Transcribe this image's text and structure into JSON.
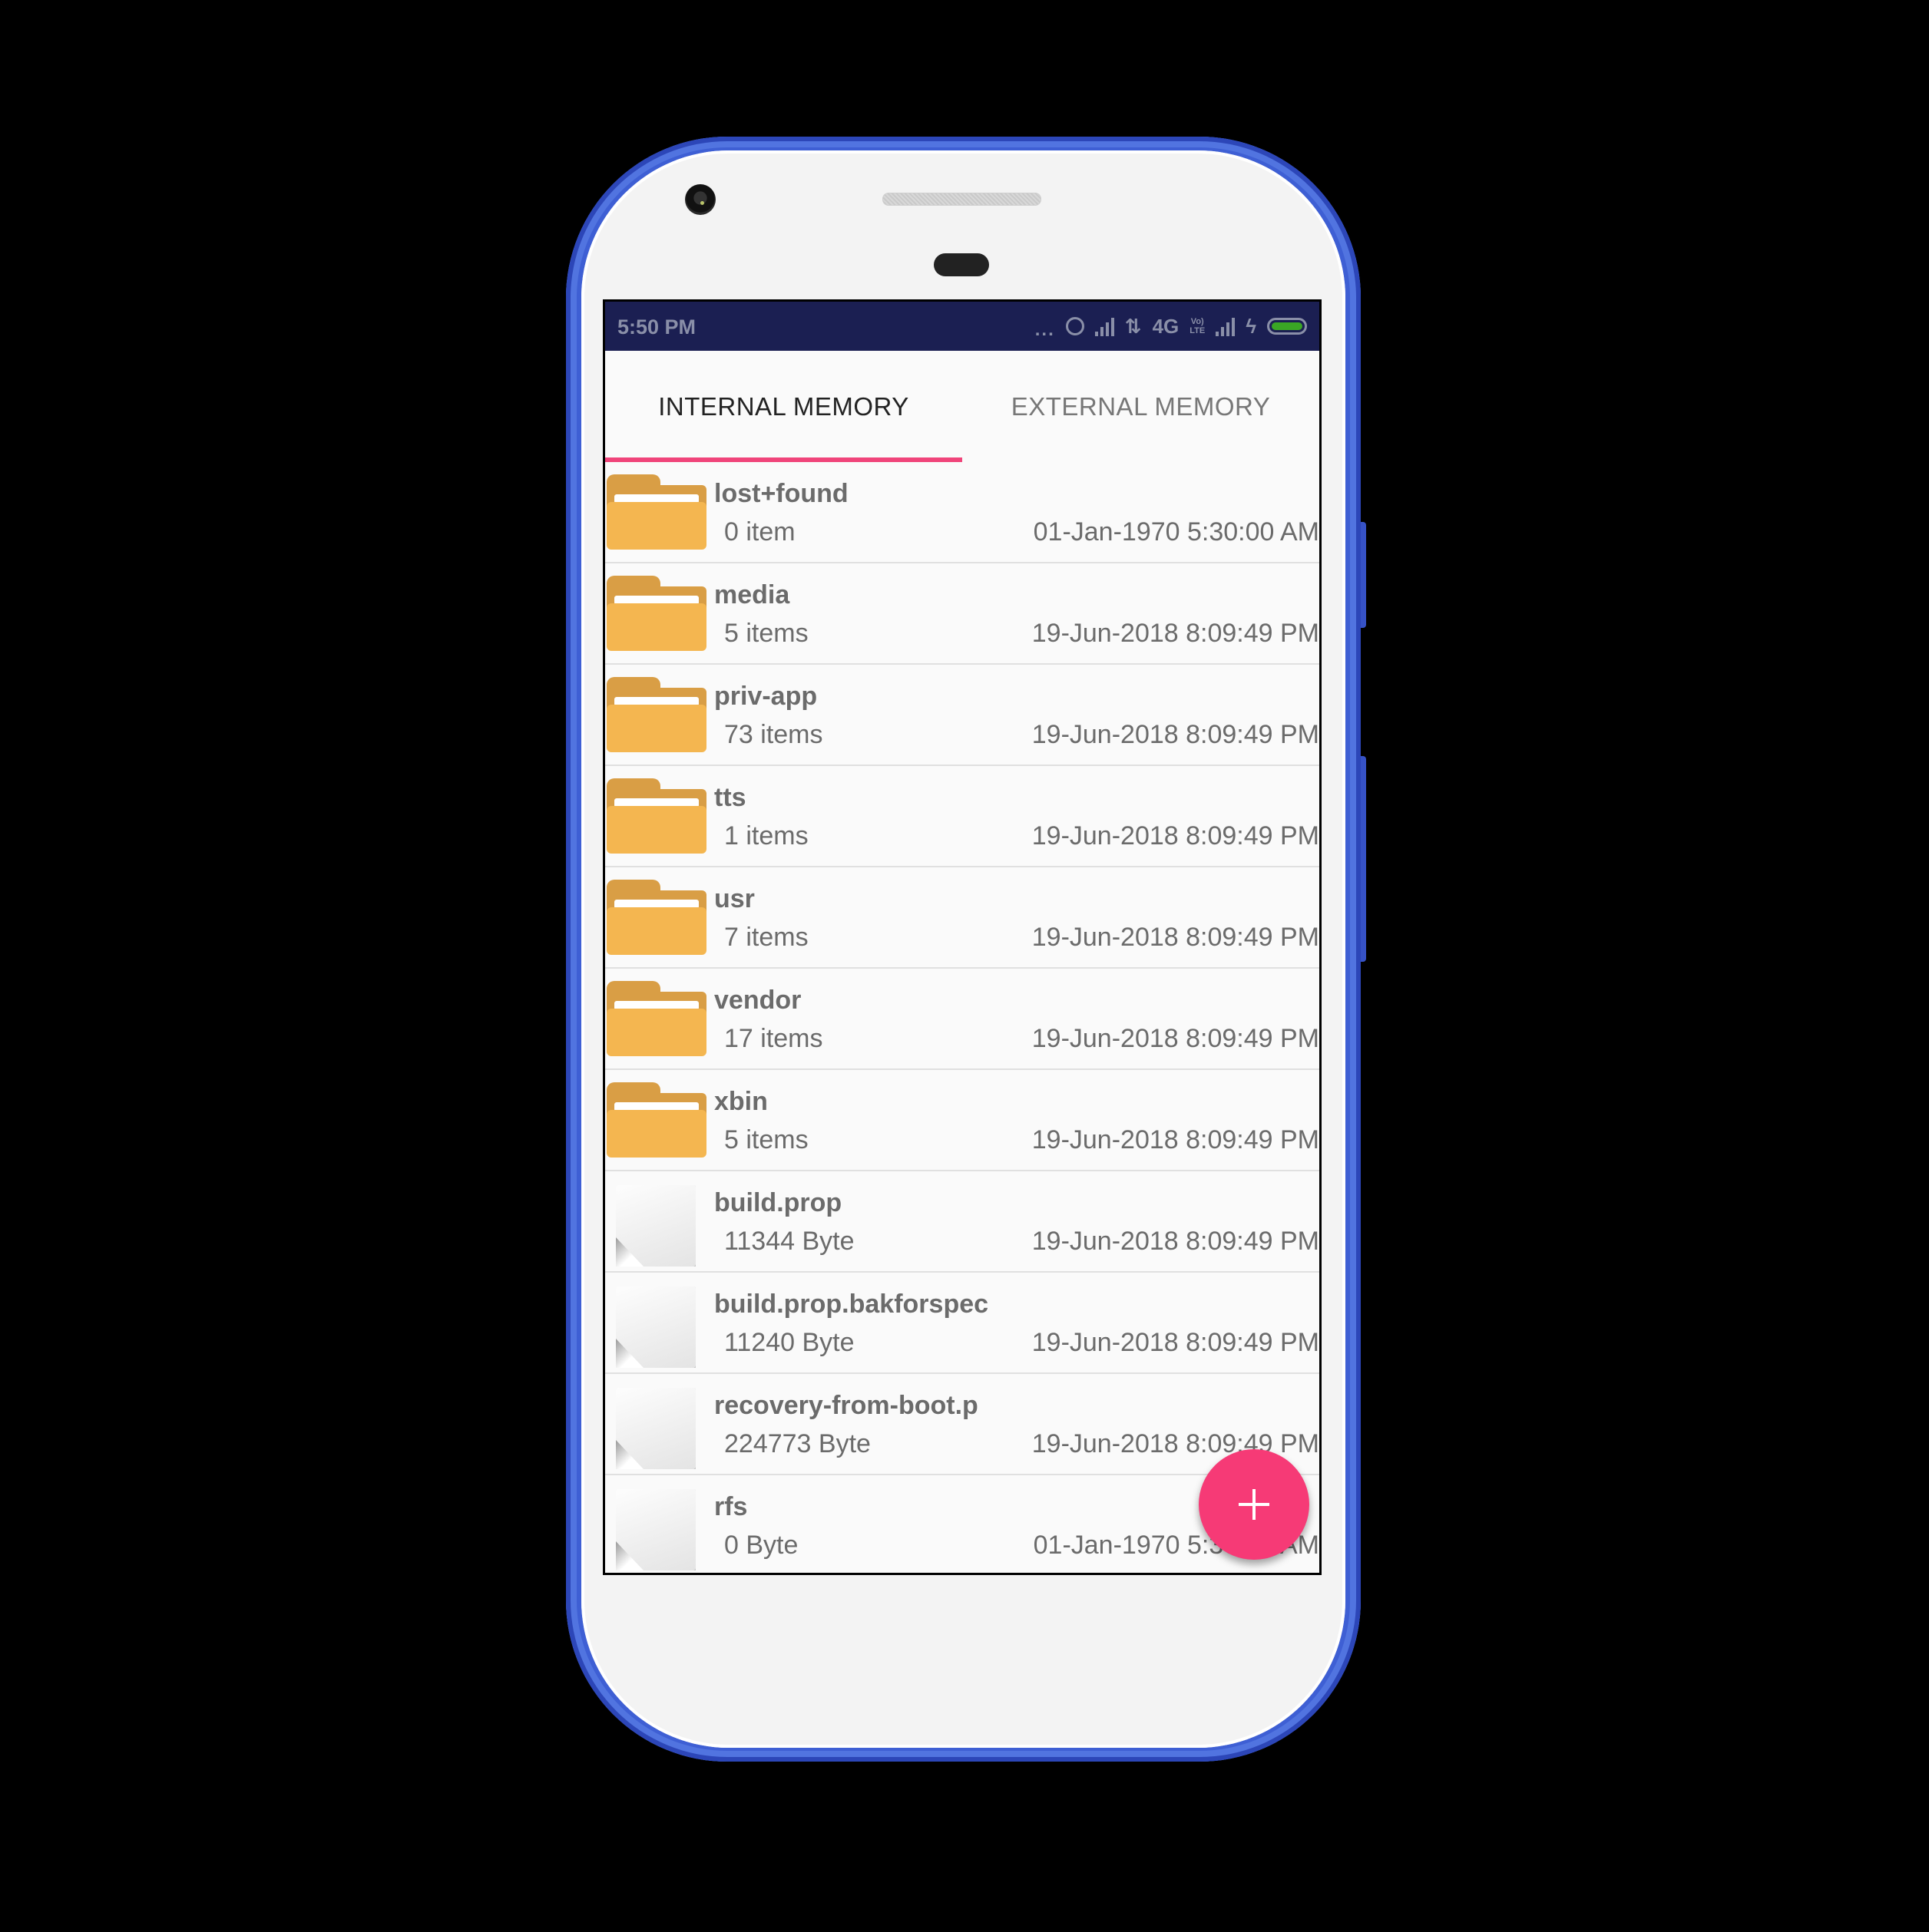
{
  "status_bar": {
    "time": "5:50 PM",
    "icons": [
      "more-dots-icon",
      "alarm-icon",
      "signal-icon",
      "data-arrows-icon",
      "network-type",
      "volte-icon",
      "signal-icon-2",
      "charging-icon",
      "battery-icon"
    ],
    "network_type": "4G",
    "volte_top": "Vo)",
    "volte_bottom": "LTE",
    "dots": "...",
    "battery_color": "#3aa625"
  },
  "tabs": [
    {
      "label": "INTERNAL MEMORY",
      "active": true
    },
    {
      "label": "EXTERNAL MEMORY",
      "active": false
    }
  ],
  "accent_color": "#f0447a",
  "files": [
    {
      "type": "folder",
      "name": "lost+found",
      "size": "0 item",
      "date": "01-Jan-1970 5:30:00 AM"
    },
    {
      "type": "folder",
      "name": "media",
      "size": "5 items",
      "date": "19-Jun-2018 8:09:49 PM"
    },
    {
      "type": "folder",
      "name": "priv-app",
      "size": "73 items",
      "date": "19-Jun-2018 8:09:49 PM"
    },
    {
      "type": "folder",
      "name": "tts",
      "size": "1 items",
      "date": "19-Jun-2018 8:09:49 PM"
    },
    {
      "type": "folder",
      "name": "usr",
      "size": "7 items",
      "date": "19-Jun-2018 8:09:49 PM"
    },
    {
      "type": "folder",
      "name": "vendor",
      "size": "17 items",
      "date": "19-Jun-2018 8:09:49 PM"
    },
    {
      "type": "folder",
      "name": "xbin",
      "size": "5 items",
      "date": "19-Jun-2018 8:09:49 PM"
    },
    {
      "type": "file",
      "name": "build.prop",
      "size": "11344 Byte",
      "date": "19-Jun-2018 8:09:49 PM"
    },
    {
      "type": "file",
      "name": "build.prop.bakforspec",
      "size": "11240 Byte",
      "date": "19-Jun-2018 8:09:49 PM"
    },
    {
      "type": "file",
      "name": "recovery-from-boot.p",
      "size": "224773 Byte",
      "date": "19-Jun-2018 8:09:49 PM"
    },
    {
      "type": "file",
      "name": "rfs",
      "size": "0 Byte",
      "date": "01-Jan-1970 5:30:00 AM"
    }
  ],
  "fab": {
    "icon": "plus-icon",
    "color": "#f63a76"
  }
}
